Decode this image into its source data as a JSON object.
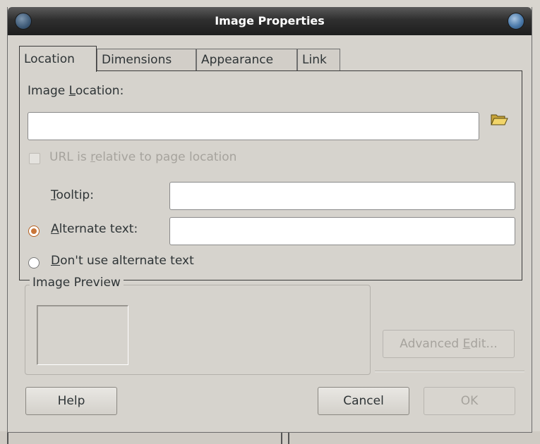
{
  "window": {
    "title": "Image Properties"
  },
  "tabs": [
    "Location",
    "Dimensions",
    "Appearance",
    "Link"
  ],
  "location": {
    "image_location_label_pre": "Image ",
    "image_location_label_u": "L",
    "image_location_label_post": "ocation:",
    "image_location_value": "",
    "relative_pre": "URL is ",
    "relative_u": "r",
    "relative_post": "elative to page location",
    "tooltip_u": "T",
    "tooltip_post": "ooltip:",
    "tooltip_value": "",
    "alt_u": "A",
    "alt_post": "lternate text:",
    "alt_value": "",
    "noalt_u": "D",
    "noalt_post": "on't use alternate text"
  },
  "preview": {
    "legend": "Image Preview"
  },
  "buttons": {
    "advanced_pre": "Advanced ",
    "advanced_u": "E",
    "advanced_post": "dit...",
    "help": "Help",
    "cancel": "Cancel",
    "ok": "OK"
  },
  "icons": {
    "browse": "folder-open-icon"
  }
}
